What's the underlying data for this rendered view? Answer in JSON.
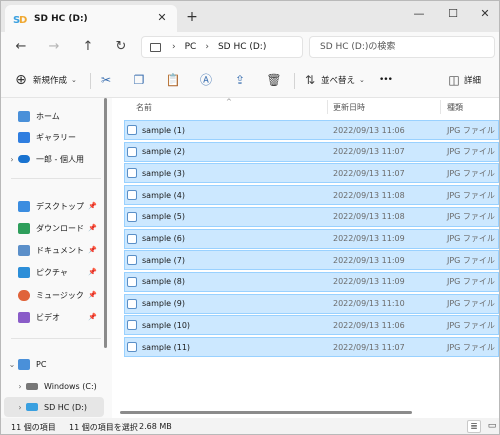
{
  "tab": {
    "title": "SD HC (D:)",
    "close_icon": "✕",
    "new_tab_icon": "+"
  },
  "window_controls": {
    "minimize": "—",
    "maximize": "☐",
    "close": "✕"
  },
  "nav": {
    "back": "←",
    "forward": "→",
    "up": "↑",
    "refresh": "↻"
  },
  "address": {
    "segments": [
      "PC",
      "SD HC (D:)"
    ],
    "separator": "›"
  },
  "search": {
    "placeholder": "SD HC (D:)の検索"
  },
  "toolbar": {
    "new_label": "新規作成",
    "sort_label": "並べ替え",
    "more_label": "•••",
    "details_label": "詳細"
  },
  "sidebar": {
    "items": [
      {
        "label": "ホーム",
        "icon": "home-icon",
        "color": "#4a90d9"
      },
      {
        "label": "ギャラリー",
        "icon": "gallery-icon",
        "color": "#2f7ee0"
      },
      {
        "label": "一郎 - 個人用",
        "icon": "onedrive-icon",
        "color": "#1a73d0"
      },
      {
        "label": "デスクトップ",
        "icon": "desktop-icon",
        "color": "#3b8de0"
      },
      {
        "label": "ダウンロード",
        "icon": "download-icon",
        "color": "#2e9e5b"
      },
      {
        "label": "ドキュメント",
        "icon": "documents-icon",
        "color": "#5b8fc9"
      },
      {
        "label": "ピクチャ",
        "icon": "pictures-icon",
        "color": "#2c8ed8"
      },
      {
        "label": "ミュージック",
        "icon": "music-icon",
        "color": "#e0633a"
      },
      {
        "label": "ビデオ",
        "icon": "videos-icon",
        "color": "#8a5cc8"
      },
      {
        "label": "PC",
        "icon": "pc-icon",
        "color": "#4a90d9"
      },
      {
        "label": "Windows (C:)",
        "icon": "drive-icon",
        "color": "#777777"
      },
      {
        "label": "SD HC (D:)",
        "icon": "sd-card-icon",
        "color": "#3aa0e0"
      }
    ]
  },
  "columns": {
    "name": "名前",
    "date": "更新日時",
    "type": "種類"
  },
  "files": [
    {
      "name": "sample (1)",
      "date": "2022/09/13 11:06",
      "type": "JPG ファイル"
    },
    {
      "name": "sample (2)",
      "date": "2022/09/13 11:07",
      "type": "JPG ファイル"
    },
    {
      "name": "sample (3)",
      "date": "2022/09/13 11:07",
      "type": "JPG ファイル"
    },
    {
      "name": "sample (4)",
      "date": "2022/09/13 11:08",
      "type": "JPG ファイル"
    },
    {
      "name": "sample (5)",
      "date": "2022/09/13 11:08",
      "type": "JPG ファイル"
    },
    {
      "name": "sample (6)",
      "date": "2022/09/13 11:09",
      "type": "JPG ファイル"
    },
    {
      "name": "sample (7)",
      "date": "2022/09/13 11:09",
      "type": "JPG ファイル"
    },
    {
      "name": "sample (8)",
      "date": "2022/09/13 11:09",
      "type": "JPG ファイル"
    },
    {
      "name": "sample (9)",
      "date": "2022/09/13 11:10",
      "type": "JPG ファイル"
    },
    {
      "name": "sample (10)",
      "date": "2022/09/13 11:06",
      "type": "JPG ファイル"
    },
    {
      "name": "sample (11)",
      "date": "2022/09/13 11:07",
      "type": "JPG ファイル"
    }
  ],
  "status": {
    "item_count": "11 個の項目",
    "selected": "11 個の項目を選択",
    "size": "2.68 MB"
  },
  "colors": {
    "selection": "#cce8ff",
    "selection_border": "#99d1ff",
    "accent": "#3a6fb0"
  }
}
